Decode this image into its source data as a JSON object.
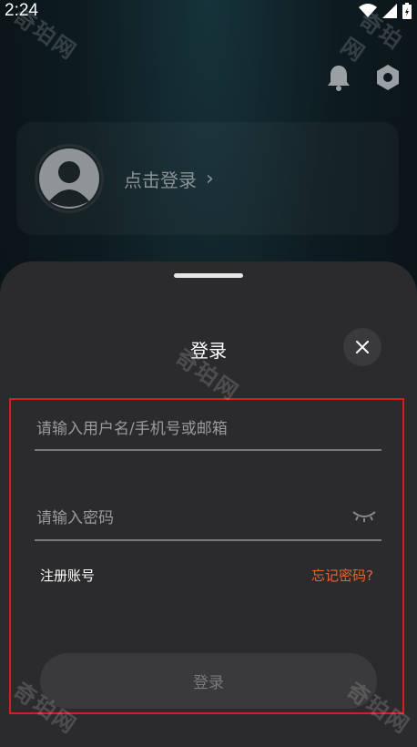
{
  "status": {
    "time": "2:24"
  },
  "profile": {
    "login_prompt": "点击登录",
    "chevron": "›"
  },
  "sheet": {
    "title": "登录",
    "username_placeholder": "请输入用户名/手机号或邮箱",
    "password_placeholder": "请输入密码",
    "register_label": "注册账号",
    "forgot_label": "忘记密码?",
    "submit_label": "登录"
  },
  "watermark": "奇珀网",
  "colors": {
    "accent": "#e8642b",
    "highlight": "#d21f1f",
    "sheet": "#2b2b2d"
  },
  "icons": [
    "wifi-icon",
    "signal-icon",
    "battery-icon",
    "bell-icon",
    "settings-icon",
    "avatar-icon",
    "close-icon",
    "eye-closed-icon"
  ]
}
